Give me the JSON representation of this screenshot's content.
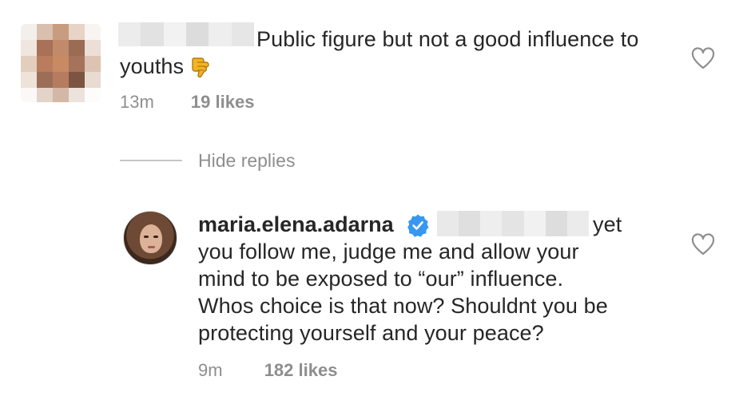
{
  "comment": {
    "text_line1": "Public figure but not a good influence to",
    "text_line2": "youths",
    "emoji": "👎",
    "time": "13m",
    "likes": "19 likes"
  },
  "hide_replies_label": "Hide replies",
  "reply": {
    "username": "maria.elena.adarna",
    "line1_tail": "yet",
    "line2": "you follow me, judge me and allow your",
    "line3": "mind to be exposed to “our” influence.",
    "line4": "Whos choice is that now? Shouldnt you be",
    "line5": "protecting yourself and your peace?",
    "time": "9m",
    "likes": "182 likes"
  },
  "colors": {
    "text": "#262626",
    "secondary": "#8e8e8e",
    "verified": "#3897f0",
    "emoji": "#f2b424"
  },
  "icons": [
    "heart-icon",
    "verified-badge-icon",
    "thumbs-down-emoji"
  ]
}
